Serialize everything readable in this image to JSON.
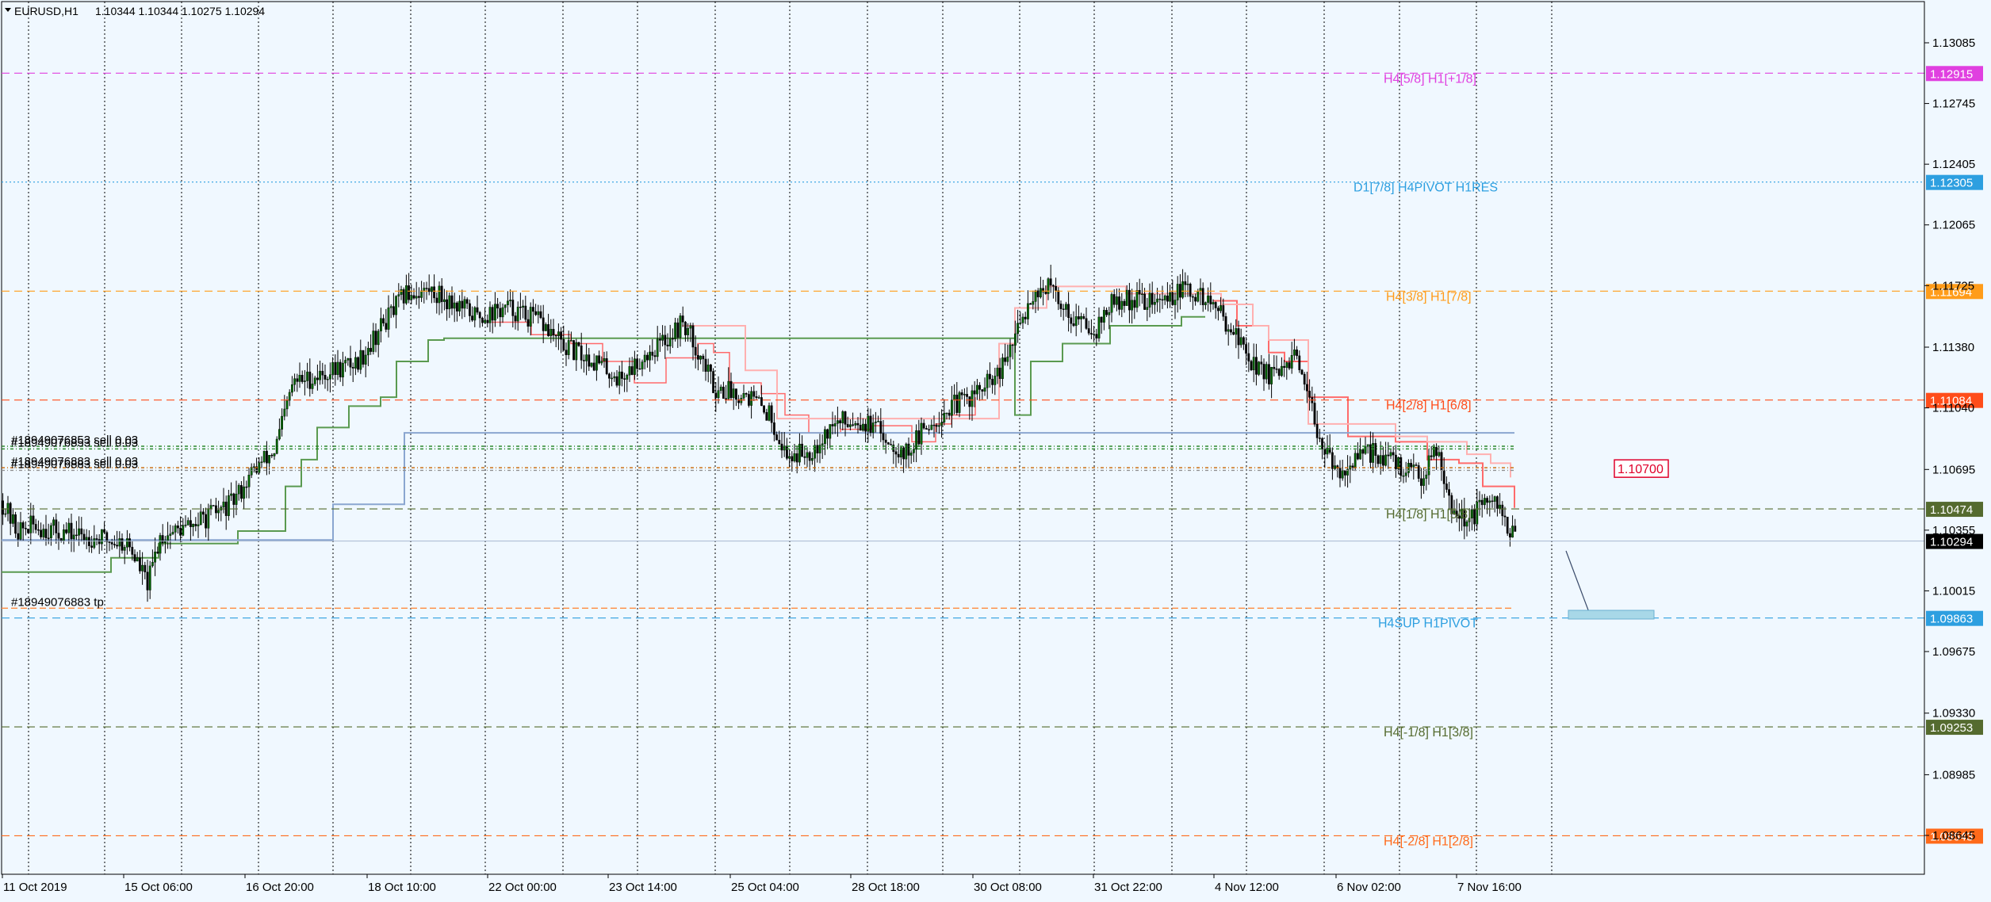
{
  "header": {
    "symbol_timeframe": "EURUSD,H1",
    "ohlc": "1.10344 1.10344 1.10275 1.10294"
  },
  "price_axis": {
    "ticks": [
      "1.13085",
      "1.12745",
      "1.12405",
      "1.12065",
      "1.11725",
      "1.11380",
      "1.11040",
      "1.10695",
      "1.10355",
      "1.10015",
      "1.09675",
      "1.09330",
      "1.08985",
      "1.08645"
    ]
  },
  "time_axis": {
    "labels": [
      "11 Oct 2019",
      "15 Oct 06:00",
      "16 Oct 20:00",
      "18 Oct 10:00",
      "22 Oct 00:00",
      "23 Oct 14:00",
      "25 Oct 04:00",
      "28 Oct 18:00",
      "30 Oct 08:00",
      "31 Oct 22:00",
      "4 Nov 12:00",
      "6 Nov 02:00",
      "7 Nov 16:00"
    ]
  },
  "levels": [
    {
      "id": "h4-5-8",
      "label": "H4[5/8] H1[+1/8]",
      "price": 1.12915,
      "price_text": "1.12915",
      "color": "#e040e0",
      "style": "dash",
      "box_text": "#ffffff"
    },
    {
      "id": "d1-7-8",
      "label": "D1[7/8] H4PIVOT H1RES",
      "price": 1.12305,
      "price_text": "1.12305",
      "color": "#2d9fe0",
      "style": "dot",
      "box_text": "#ffffff"
    },
    {
      "id": "h4-3-8",
      "label": "H4[3/8] H1[7/8]",
      "price": 1.11694,
      "price_text": "1.11694",
      "color": "#ff9c1a",
      "style": "dash",
      "box_text": "#ffffff"
    },
    {
      "id": "h4-2-8",
      "label": "H4[2/8] H1[6/8]",
      "price": 1.11084,
      "price_text": "1.11084",
      "color": "#ff4d1a",
      "style": "dash",
      "box_text": "#ffffff"
    },
    {
      "id": "h4-1-8",
      "label": "H4[1/8] H1[5/8]",
      "price": 1.10474,
      "price_text": "1.10474",
      "color": "#556b2f",
      "style": "dash",
      "box_text": "#ffffff"
    },
    {
      "id": "h4sup",
      "label": "H4SUP H1PIVOT",
      "price": 1.09863,
      "price_text": "1.09863",
      "color": "#2d9fe0",
      "style": "dash",
      "box_text": "#ffffff"
    },
    {
      "id": "h4-m1-8",
      "label": "H4[-1/8] H1[3/8]",
      "price": 1.09253,
      "price_text": "1.09253",
      "color": "#556b2f",
      "style": "dash",
      "box_text": "#ffffff"
    },
    {
      "id": "h4-m2-8",
      "label": "H4[-2/8] H1[2/8]",
      "price": 1.08643,
      "price_text": "1.08643",
      "color": "#ff6a1a",
      "style": "dash",
      "box_text": "#ffffff"
    }
  ],
  "current_price": {
    "price": 1.10294,
    "price_text": "1.10294",
    "color": "#000000"
  },
  "alert_box": {
    "text": "1.10700",
    "price": 1.107,
    "color": "#e0002a"
  },
  "orders": [
    {
      "text": "#18949076853 sell 0.03",
      "price": 1.10825
    },
    {
      "text": "#18949076853 sell 0.03",
      "price": 1.1081
    },
    {
      "text": "#18949076883 sell 0.03",
      "price": 1.10705
    },
    {
      "text": "#18949076883 sell 0.03",
      "price": 1.1069
    },
    {
      "text": "#18949076883 tp",
      "price": 1.09918
    }
  ],
  "colors": {
    "background": "#f0f8ff",
    "bull_candle": "#006400",
    "bear_candle": "#000000",
    "stop_green": "#5a9a50",
    "stop_red": "#ff6b6b",
    "stop_pink": "#ffb0b0",
    "stop_blue": "#8aa6d0",
    "grid": "#000000"
  }
}
